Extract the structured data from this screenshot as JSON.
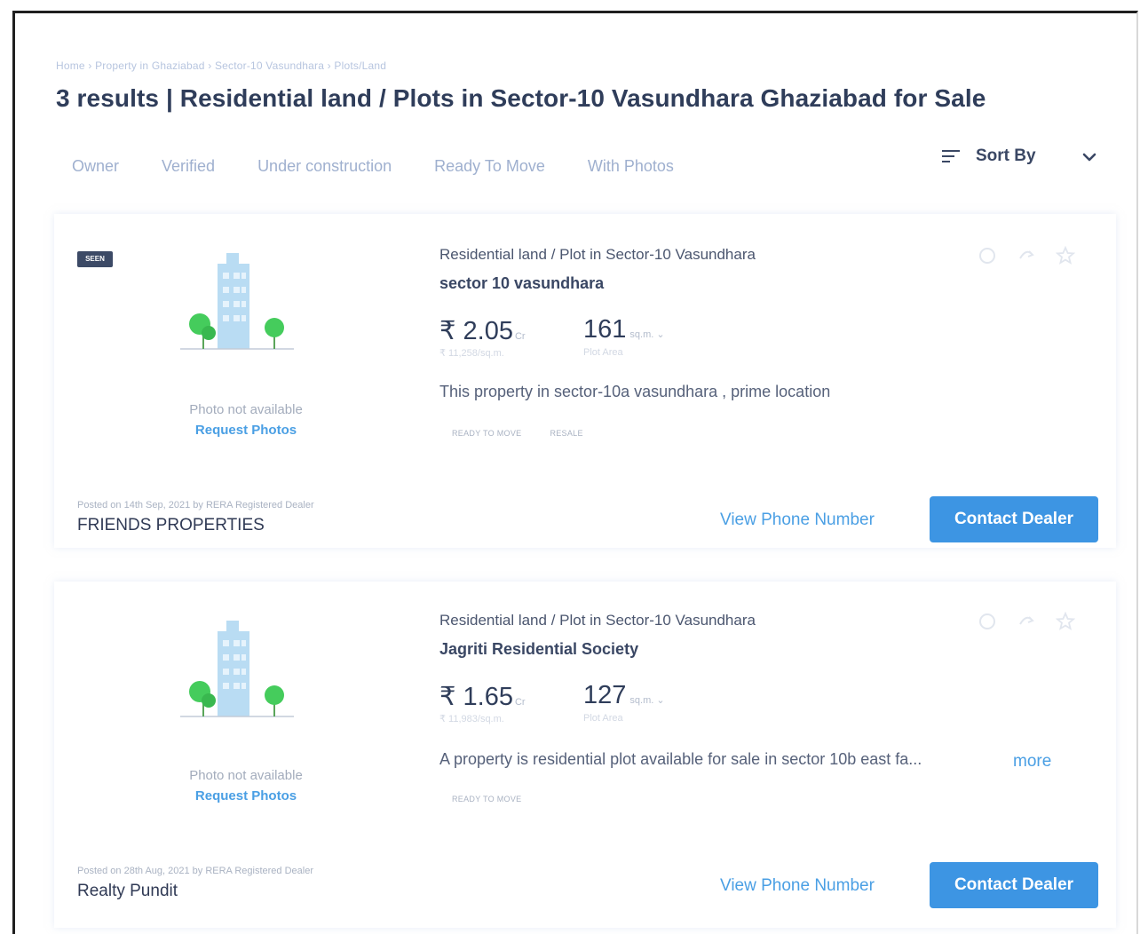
{
  "breadcrumb": "Home › Property in Ghaziabad › Sector-10 Vasundhara › Plots/Land",
  "title": "3 results | Residential land / Plots in Sector-10 Vasundhara Ghaziabad for Sale",
  "filters": [
    "Owner",
    "Verified",
    "Under construction",
    "Ready To Move",
    "With Photos"
  ],
  "sort": {
    "label": "Sort By"
  },
  "colors": {
    "accent": "#3d95e3",
    "link": "#4a9fe4",
    "title": "#2f3d5a"
  },
  "listings": [
    {
      "badge": "SEEN",
      "photo_not_available": "Photo not available",
      "request_photos": "Request Photos",
      "property_type": "Residential land / Plot in Sector-10 Vasundhara",
      "project": "sector 10 vasundhara",
      "price": "₹ 2.05",
      "price_unit": "Cr",
      "price_per_unit": "₹ 11,258/sq.m.",
      "area": "161",
      "area_unit": "sq.m. ⌄",
      "area_label": "Plot Area",
      "description": "This property in sector-10a vasundhara , prime location",
      "tags": [
        "READY TO MOVE",
        "RESALE"
      ],
      "posted_meta": "Posted on 14th Sep, 2021 by RERA Registered Dealer",
      "dealer": "FRIENDS PROPERTIES",
      "view_phone": "View Phone Number",
      "contact": "Contact Dealer"
    },
    {
      "photo_not_available": "Photo not available",
      "request_photos": "Request Photos",
      "property_type": "Residential land / Plot in Sector-10 Vasundhara",
      "project": "Jagriti Residential Society",
      "price": "₹ 1.65",
      "price_unit": "Cr",
      "price_per_unit": "₹ 11,983/sq.m.",
      "area": "127",
      "area_unit": "sq.m. ⌄",
      "area_label": "Plot Area",
      "description": "A property is residential plot available for sale in sector 10b east fa...",
      "more": "more",
      "tags": [
        "READY TO MOVE"
      ],
      "posted_meta": "Posted on 28th Aug, 2021 by RERA Registered Dealer",
      "dealer": "Realty Pundit",
      "view_phone": "View Phone Number",
      "contact": "Contact Dealer"
    }
  ]
}
